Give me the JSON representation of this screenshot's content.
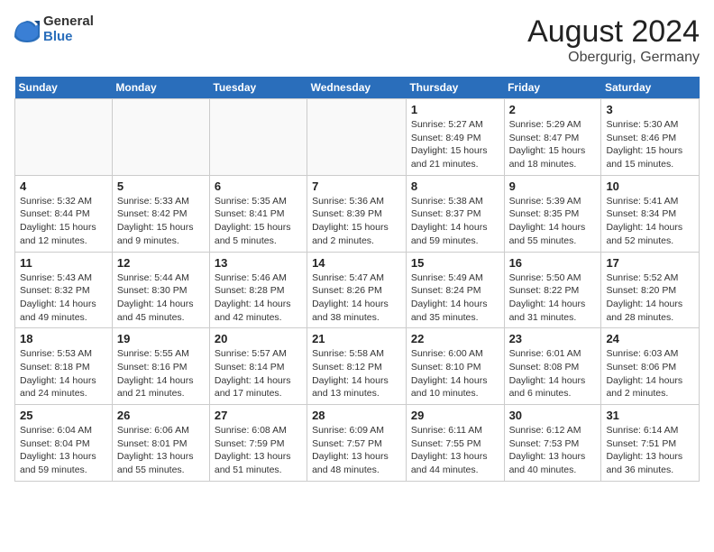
{
  "header": {
    "logo_general": "General",
    "logo_blue": "Blue",
    "month_year": "August 2024",
    "location": "Obergurig, Germany"
  },
  "days_of_week": [
    "Sunday",
    "Monday",
    "Tuesday",
    "Wednesday",
    "Thursday",
    "Friday",
    "Saturday"
  ],
  "weeks": [
    [
      {
        "day": "",
        "info": ""
      },
      {
        "day": "",
        "info": ""
      },
      {
        "day": "",
        "info": ""
      },
      {
        "day": "",
        "info": ""
      },
      {
        "day": "1",
        "info": "Sunrise: 5:27 AM\nSunset: 8:49 PM\nDaylight: 15 hours\nand 21 minutes."
      },
      {
        "day": "2",
        "info": "Sunrise: 5:29 AM\nSunset: 8:47 PM\nDaylight: 15 hours\nand 18 minutes."
      },
      {
        "day": "3",
        "info": "Sunrise: 5:30 AM\nSunset: 8:46 PM\nDaylight: 15 hours\nand 15 minutes."
      }
    ],
    [
      {
        "day": "4",
        "info": "Sunrise: 5:32 AM\nSunset: 8:44 PM\nDaylight: 15 hours\nand 12 minutes."
      },
      {
        "day": "5",
        "info": "Sunrise: 5:33 AM\nSunset: 8:42 PM\nDaylight: 15 hours\nand 9 minutes."
      },
      {
        "day": "6",
        "info": "Sunrise: 5:35 AM\nSunset: 8:41 PM\nDaylight: 15 hours\nand 5 minutes."
      },
      {
        "day": "7",
        "info": "Sunrise: 5:36 AM\nSunset: 8:39 PM\nDaylight: 15 hours\nand 2 minutes."
      },
      {
        "day": "8",
        "info": "Sunrise: 5:38 AM\nSunset: 8:37 PM\nDaylight: 14 hours\nand 59 minutes."
      },
      {
        "day": "9",
        "info": "Sunrise: 5:39 AM\nSunset: 8:35 PM\nDaylight: 14 hours\nand 55 minutes."
      },
      {
        "day": "10",
        "info": "Sunrise: 5:41 AM\nSunset: 8:34 PM\nDaylight: 14 hours\nand 52 minutes."
      }
    ],
    [
      {
        "day": "11",
        "info": "Sunrise: 5:43 AM\nSunset: 8:32 PM\nDaylight: 14 hours\nand 49 minutes."
      },
      {
        "day": "12",
        "info": "Sunrise: 5:44 AM\nSunset: 8:30 PM\nDaylight: 14 hours\nand 45 minutes."
      },
      {
        "day": "13",
        "info": "Sunrise: 5:46 AM\nSunset: 8:28 PM\nDaylight: 14 hours\nand 42 minutes."
      },
      {
        "day": "14",
        "info": "Sunrise: 5:47 AM\nSunset: 8:26 PM\nDaylight: 14 hours\nand 38 minutes."
      },
      {
        "day": "15",
        "info": "Sunrise: 5:49 AM\nSunset: 8:24 PM\nDaylight: 14 hours\nand 35 minutes."
      },
      {
        "day": "16",
        "info": "Sunrise: 5:50 AM\nSunset: 8:22 PM\nDaylight: 14 hours\nand 31 minutes."
      },
      {
        "day": "17",
        "info": "Sunrise: 5:52 AM\nSunset: 8:20 PM\nDaylight: 14 hours\nand 28 minutes."
      }
    ],
    [
      {
        "day": "18",
        "info": "Sunrise: 5:53 AM\nSunset: 8:18 PM\nDaylight: 14 hours\nand 24 minutes."
      },
      {
        "day": "19",
        "info": "Sunrise: 5:55 AM\nSunset: 8:16 PM\nDaylight: 14 hours\nand 21 minutes."
      },
      {
        "day": "20",
        "info": "Sunrise: 5:57 AM\nSunset: 8:14 PM\nDaylight: 14 hours\nand 17 minutes."
      },
      {
        "day": "21",
        "info": "Sunrise: 5:58 AM\nSunset: 8:12 PM\nDaylight: 14 hours\nand 13 minutes."
      },
      {
        "day": "22",
        "info": "Sunrise: 6:00 AM\nSunset: 8:10 PM\nDaylight: 14 hours\nand 10 minutes."
      },
      {
        "day": "23",
        "info": "Sunrise: 6:01 AM\nSunset: 8:08 PM\nDaylight: 14 hours\nand 6 minutes."
      },
      {
        "day": "24",
        "info": "Sunrise: 6:03 AM\nSunset: 8:06 PM\nDaylight: 14 hours\nand 2 minutes."
      }
    ],
    [
      {
        "day": "25",
        "info": "Sunrise: 6:04 AM\nSunset: 8:04 PM\nDaylight: 13 hours\nand 59 minutes."
      },
      {
        "day": "26",
        "info": "Sunrise: 6:06 AM\nSunset: 8:01 PM\nDaylight: 13 hours\nand 55 minutes."
      },
      {
        "day": "27",
        "info": "Sunrise: 6:08 AM\nSunset: 7:59 PM\nDaylight: 13 hours\nand 51 minutes."
      },
      {
        "day": "28",
        "info": "Sunrise: 6:09 AM\nSunset: 7:57 PM\nDaylight: 13 hours\nand 48 minutes."
      },
      {
        "day": "29",
        "info": "Sunrise: 6:11 AM\nSunset: 7:55 PM\nDaylight: 13 hours\nand 44 minutes."
      },
      {
        "day": "30",
        "info": "Sunrise: 6:12 AM\nSunset: 7:53 PM\nDaylight: 13 hours\nand 40 minutes."
      },
      {
        "day": "31",
        "info": "Sunrise: 6:14 AM\nSunset: 7:51 PM\nDaylight: 13 hours\nand 36 minutes."
      }
    ]
  ]
}
